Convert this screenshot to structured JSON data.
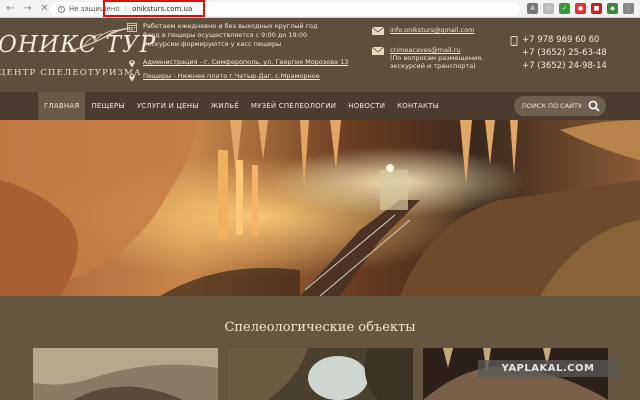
{
  "browser": {
    "secure_label": "Не защищено",
    "url": "oniksturs.com.ua"
  },
  "header": {
    "logo_text": "ОНИКС ТУР",
    "logo_sub": "ЦЕНТР СПЕЛЕОТУРИЗМА",
    "hours_lines": [
      "Работаем ежедневно и без выходных круглый год",
      "Вход в пещеры осуществляется с 9:00 до 19:00",
      "Экскурсии формируются у касс пещеры"
    ],
    "address_admin": "Администрация - г. Симферополь, ул. Георгия Морозова 13",
    "address_caves": "Пещеры - Нижнее плато г.Чатыр-Даг, с.Мраморное",
    "email_1": "info.oniksturs@gmail.com",
    "email_2": "crimeacaves@mail.ru",
    "email_2_note": "(По вопросам размещения, экскурсий и транспорта)",
    "phones": [
      "+7 978 969 60 60",
      "+7 (3652) 25-63-48",
      "+7 (3652) 24-98-14"
    ]
  },
  "nav": {
    "items": [
      "ГЛАВНАЯ",
      "ПЕЩЕРЫ",
      "УСЛУГИ И ЦЕНЫ",
      "ЖИЛЬЁ",
      "МУЗЕЙ СПЕЛЕОЛОГИИ",
      "НОВОСТИ",
      "КОНТАКТЫ"
    ],
    "active_index": 0,
    "search_placeholder": "ПОИСК ПО САЙТУ"
  },
  "section": {
    "title": "Спелеологические объекты"
  },
  "watermark": "YAPLAKAL.COM",
  "colors": {
    "header_bg": "#5e4f3d",
    "nav_bg": "#4a3d30",
    "highlight": "#e01010"
  }
}
